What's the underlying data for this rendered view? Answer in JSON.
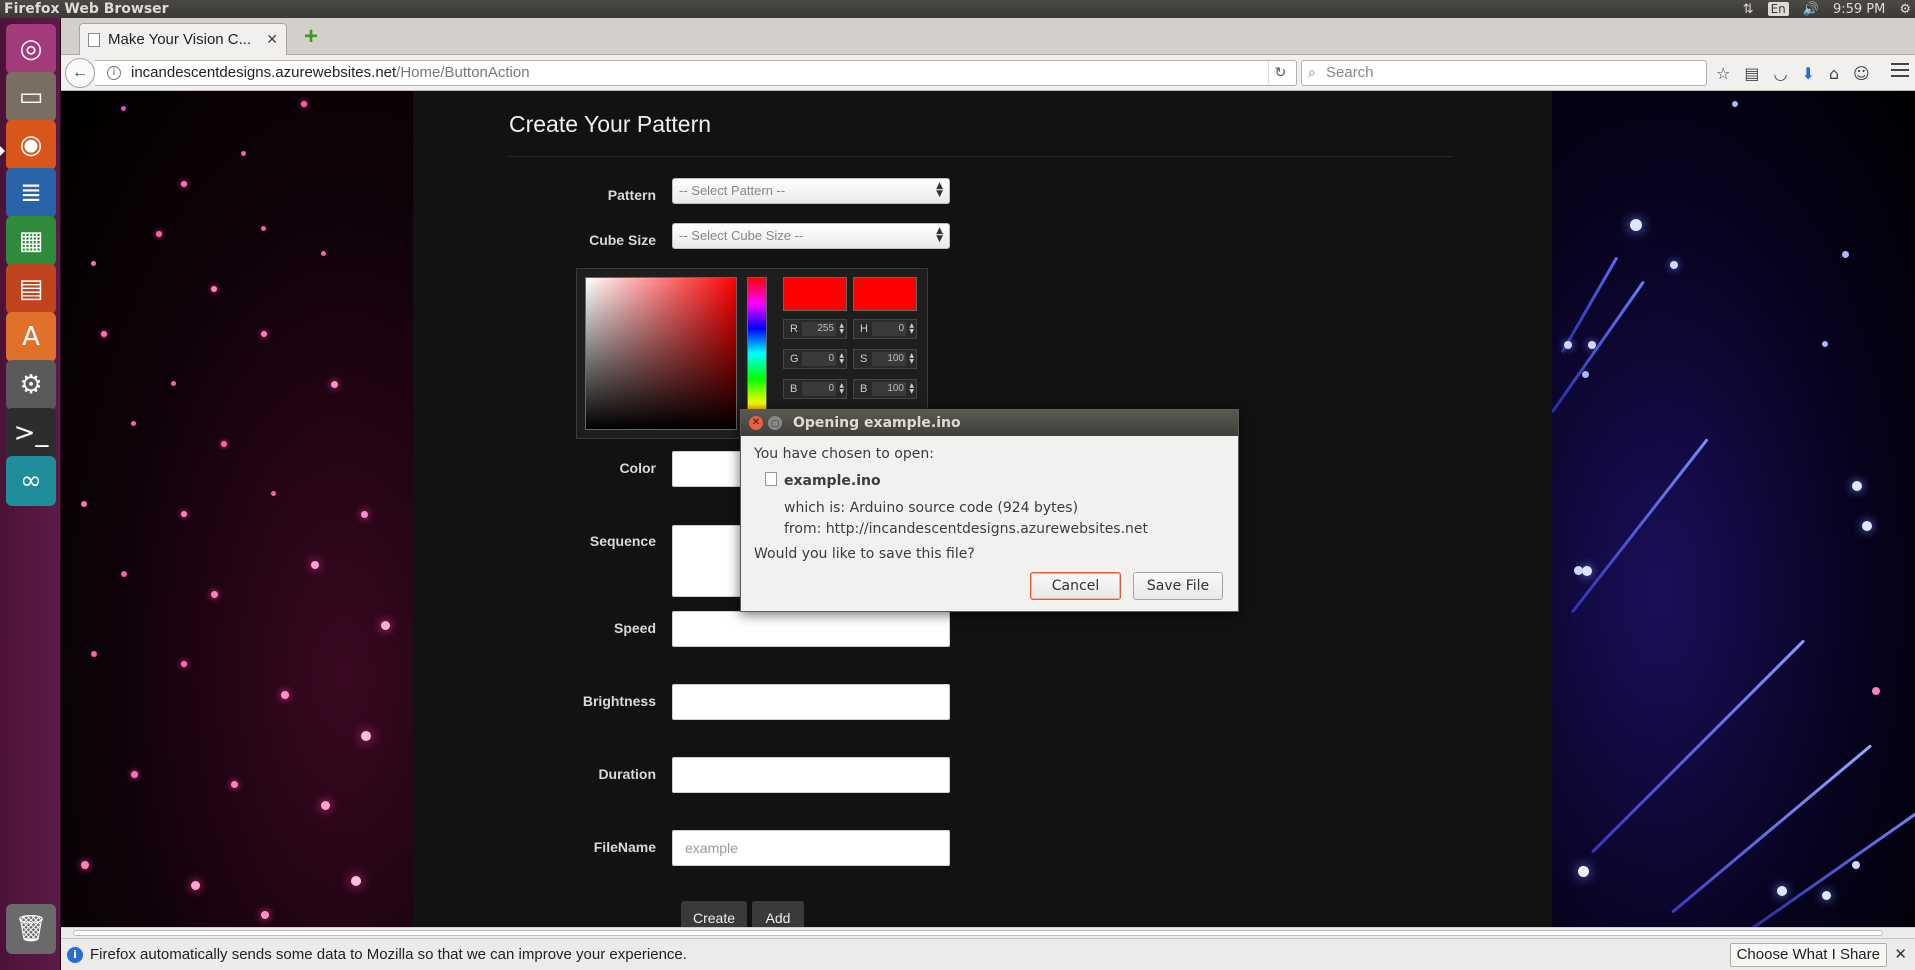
{
  "system": {
    "app_title": "Firefox Web Browser",
    "lang": "En",
    "time": "9:59 PM"
  },
  "browser": {
    "tab_title": "Make Your Vision C...",
    "url_host": "incandescentdesigns.azurewebsites.net",
    "url_path": "/Home/ButtonAction",
    "search_placeholder": "Search"
  },
  "page": {
    "title": "Create Your Pattern",
    "labels": {
      "pattern": "Pattern",
      "cube_size": "Cube Size",
      "color": "Color",
      "sequence": "Sequence",
      "speed": "Speed",
      "brightness": "Brightness",
      "duration": "Duration",
      "filename": "FileName"
    },
    "pattern_select": "-- Select Pattern --",
    "cube_size_select": "-- Select Cube Size --",
    "filename_placeholder": "example",
    "buttons": {
      "create": "Create",
      "add": "Add"
    },
    "color_picker": {
      "r_label": "R",
      "r": "255",
      "g_label": "G",
      "g": "0",
      "b_label": "B",
      "b": "0",
      "h_label": "H",
      "h": "0",
      "s_label": "S",
      "s": "100",
      "bv_label": "B",
      "bv": "100",
      "color": "#ff0000"
    }
  },
  "dialog": {
    "title": "Opening example.ino",
    "intro": "You have chosen to open:",
    "filename": "example.ino",
    "which_is": "which is:  Arduino source code (924 bytes)",
    "from": "from:  http://incandescentdesigns.azurewebsites.net",
    "question": "Would you like to save this file?",
    "cancel": "Cancel",
    "save": "Save File"
  },
  "notification": {
    "message": "Firefox automatically sends some data to Mozilla so that we can improve your experience.",
    "action": "Choose What I Share"
  }
}
